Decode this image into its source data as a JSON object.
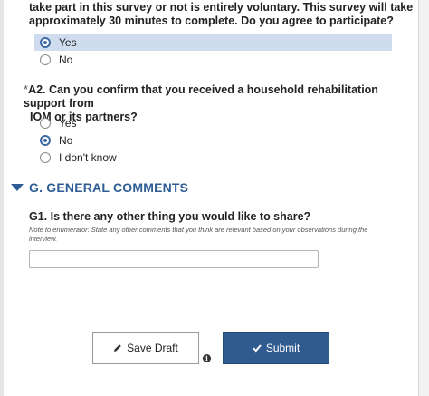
{
  "q1": {
    "text_line1": "take part in this survey or not is entirely voluntary. This survey will take",
    "text_line2": "approximately 30 minutes to complete. Do you agree to participate?",
    "options": [
      "Yes",
      "No"
    ],
    "selected": "Yes"
  },
  "a2": {
    "required_marker": "*",
    "text_line1": "A2. Can you confirm that you received a household rehabilitation support from",
    "text_line2": "IOM or its partners?",
    "options": [
      "Yes",
      "No",
      "I don't know"
    ],
    "selected": "No"
  },
  "section_g": {
    "title": "G. GENERAL COMMENTS"
  },
  "g1": {
    "question": "G1. Is there any other thing you would like to share?",
    "note": "Note to enumerator: State any other comments that you think are relevant based on your observations during the interview.",
    "value": ""
  },
  "actions": {
    "save_draft_label": "Save Draft",
    "submit_label": "Submit",
    "info_glyph": "i"
  },
  "colors": {
    "accent": "#2f5b91",
    "selected_row": "#cfdcee",
    "section_heading": "#2e5d96"
  },
  "icons": {
    "save_draft": "pencil-icon",
    "submit": "check-icon",
    "info": "info-icon",
    "section_toggle": "triangle-down-icon"
  }
}
